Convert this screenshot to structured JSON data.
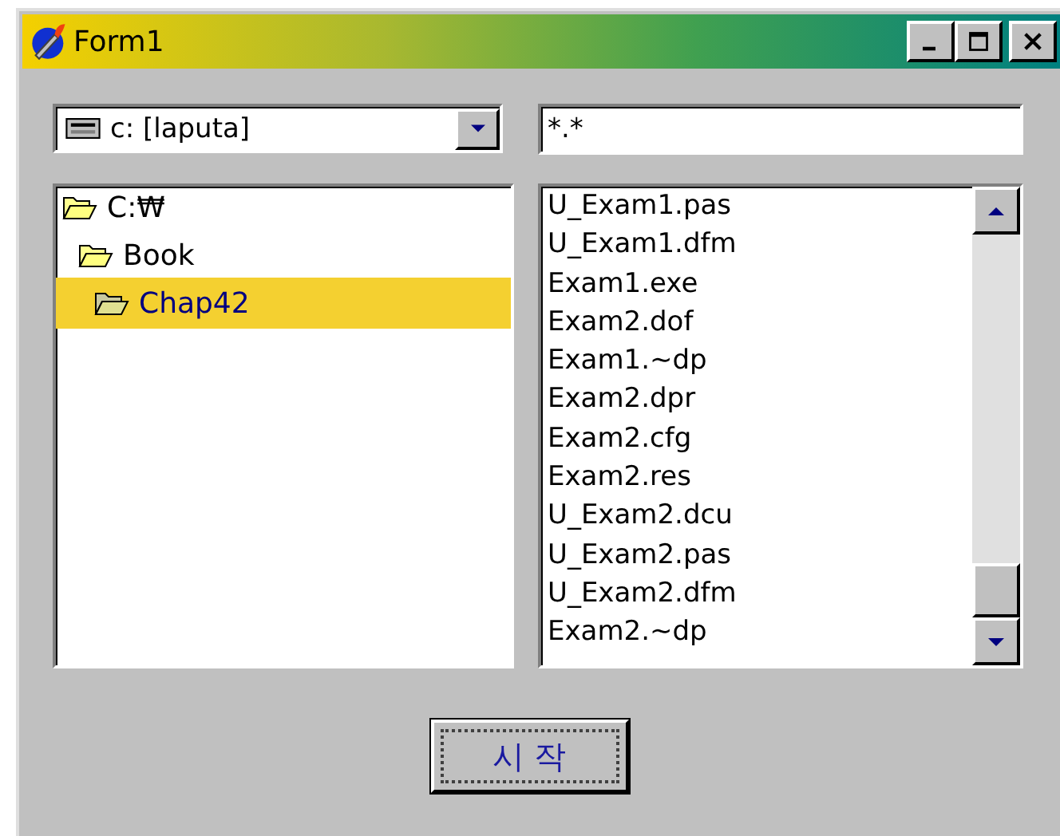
{
  "window": {
    "title": "Form1",
    "buttons": [
      {
        "kind": "minimize"
      },
      {
        "kind": "maximize"
      },
      {
        "kind": "close"
      }
    ]
  },
  "drive_combo": {
    "value": "c: [laputa]"
  },
  "filter_field": {
    "value": "*.*"
  },
  "folders": [
    {
      "label": "C:₩",
      "selected": false,
      "children": [
        {
          "label": "Book",
          "selected": false,
          "children": [
            {
              "label": "Chap42",
              "selected": true
            }
          ]
        }
      ]
    }
  ],
  "files": [
    "U_Exam1.pas",
    "U_Exam1.dfm",
    "Exam1.exe",
    "Exam2.dof",
    "Exam1.~dp",
    "Exam2.dpr",
    "Exam2.cfg",
    "Exam2.res",
    "U_Exam2.dcu",
    "U_Exam2.pas",
    "U_Exam2.dfm",
    "Exam2.~dp"
  ],
  "start_button": {
    "label": "시 작"
  }
}
